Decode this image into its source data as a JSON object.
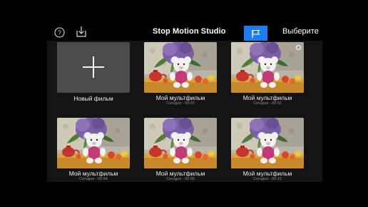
{
  "header": {
    "title": "Stop Motion Studio",
    "select_label": "Выберите",
    "help_icon": "help-circle-icon",
    "download_icon": "download-tray-icon",
    "flag_icon": "flag-icon",
    "accent": "#1d7cf2"
  },
  "new_movie": {
    "label": "Новый фильм",
    "icon": "plus-icon",
    "tile_color": "#4b4b4b"
  },
  "movies": [
    {
      "title": "Мой мультфильм",
      "subtitle": "Сегодня - 00:03"
    },
    {
      "title": "Мой мультфильм",
      "subtitle": "Сегодня - 00:01"
    },
    {
      "title": "Мой мультфильм",
      "subtitle": "Сегодня - 00:04"
    },
    {
      "title": "Мой мультфильм",
      "subtitle": "Сегодня - 00:05"
    },
    {
      "title": "Мой мультфильм",
      "subtitle": "Сегодня - 00:13"
    }
  ]
}
